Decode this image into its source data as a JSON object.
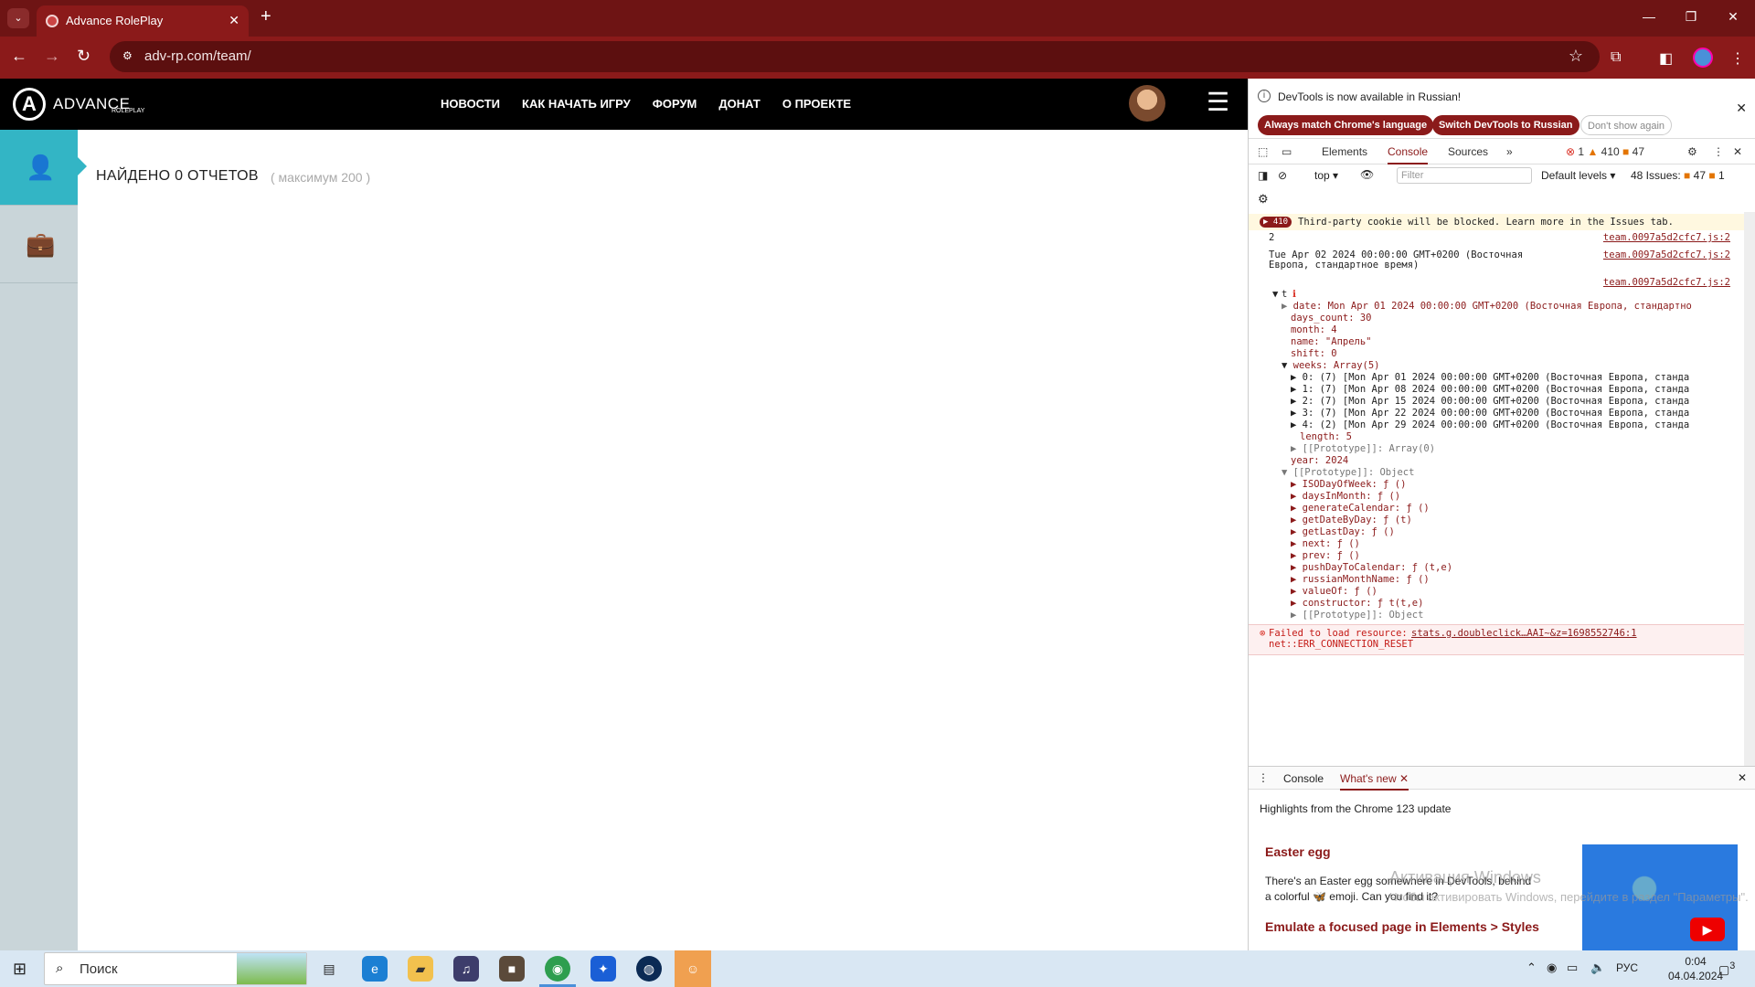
{
  "browser": {
    "tab_title": "Advance RolePlay",
    "url": "adv-rp.com/team/"
  },
  "site": {
    "logo_text": "ADVANCE",
    "logo_sub": "ROLEPLAY",
    "nav": [
      "НОВОСТИ",
      "КАК НАЧАТЬ ИГРУ",
      "ФОРУМ",
      "ДОНАТ",
      "О ПРОЕКТЕ"
    ],
    "found": "НАЙДЕНО 0 ОТЧЕТОВ",
    "max_note": "( максимум 200 )"
  },
  "devtools": {
    "info": "DevTools is now available in Russian!",
    "btn_match": "Always match Chrome's language",
    "btn_switch": "Switch DevTools to Russian",
    "btn_dismiss": "Don't show again",
    "tabs": [
      "Elements",
      "Console",
      "Sources"
    ],
    "err_count": "1",
    "warn_count": "410",
    "issue_count": "47",
    "context": "top",
    "filter_placeholder": "Filter",
    "levels": "Default levels",
    "issues": "48 Issues:",
    "issues_warn": "47",
    "issues_info": "1",
    "warn_badge": "410",
    "warn_text": "Third-party cookie will be blocked. Learn more in the Issues tab.",
    "src": "team.0097a5d2cfc7.js:2",
    "log1": "2",
    "log2a": "Tue Apr 02 2024 00:00:00 GMT+0200 (Восточная",
    "log2b": "Европа, стандартное время)",
    "obj_t": "t",
    "date_line": "date: Mon Apr 01 2024 00:00:00 GMT+0200 (Восточная Европа, стандартно",
    "days_count": "days_count: 30",
    "month": "month: 4",
    "name": "name: \"Апрель\"",
    "shift": "shift: 0",
    "weeks": "weeks: Array(5)",
    "w0": "0: (7) [Mon Apr 01 2024 00:00:00 GMT+0200 (Восточная Европа, станда",
    "w1": "1: (7) [Mon Apr 08 2024 00:00:00 GMT+0200 (Восточная Европа, станда",
    "w2": "2: (7) [Mon Apr 15 2024 00:00:00 GMT+0200 (Восточная Европа, станда",
    "w3": "3: (7) [Mon Apr 22 2024 00:00:00 GMT+0200 (Восточная Европа, станда",
    "w4": "4: (2) [Mon Apr 29 2024 00:00:00 GMT+0200 (Восточная Европа, станда",
    "length": "length: 5",
    "proto_arr": "[[Prototype]]: Array(0)",
    "year": "year: 2024",
    "proto_obj": "[[Prototype]]: Object",
    "methods": [
      "ISODayOfWeek: ƒ ()",
      "daysInMonth: ƒ ()",
      "generateCalendar: ƒ ()",
      "getDateByDay: ƒ (t)",
      "getLastDay: ƒ ()",
      "next: ƒ ()",
      "prev: ƒ ()",
      "pushDayToCalendar: ƒ (t,e)",
      "russianMonthName: ƒ ()",
      "valueOf: ƒ ()",
      "constructor: ƒ t(t,e)",
      "[[Prototype]]: Object"
    ],
    "err1": "Failed to load resource:",
    "err2": "net::ERR_CONNECTION_RESET",
    "err_src": "stats.g.doubleclick…AAI~&z=1698552746:1",
    "drawer_tabs": [
      "Console",
      "What's new"
    ],
    "drawer_title": "Highlights from the Chrome 123 update",
    "wn_h1": "Easter egg",
    "wn_p": "There's an Easter egg somewhere in DevTools, behind a colorful 🦋 emoji. Can you find it?",
    "wn_h2": "Emulate a focused page in Elements > Styles"
  },
  "watermark": {
    "line1": "Активация Windows",
    "line2": "Чтобы активировать Windows, перейдите в раздел \"Параметры\"."
  },
  "taskbar": {
    "search": "Поиск",
    "lang": "РУС",
    "time": "0:04",
    "date": "04.04.2024",
    "notif": "3"
  }
}
